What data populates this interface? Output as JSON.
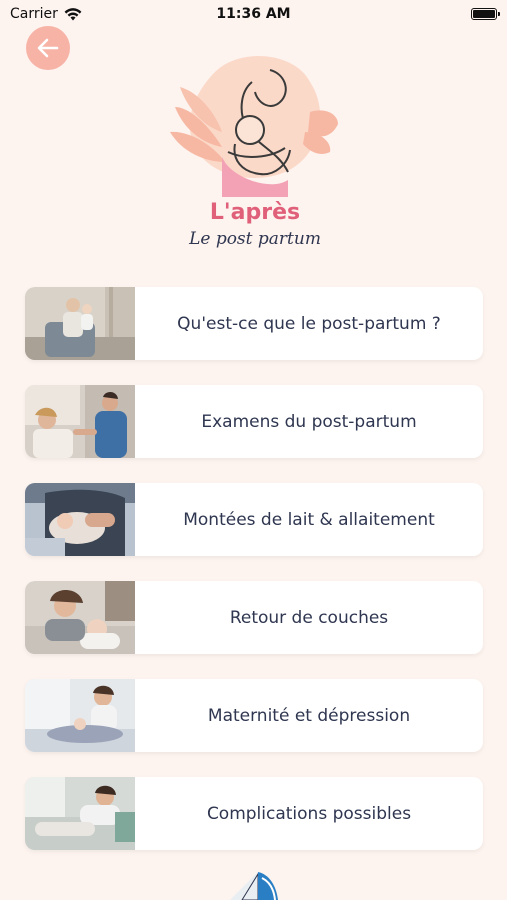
{
  "status_bar": {
    "carrier": "Carrier",
    "time": "11:36 AM"
  },
  "header": {
    "logo_title": "L'après",
    "logo_subtitle": "Le post partum"
  },
  "menu": {
    "items": [
      {
        "label": "Qu'est-ce que le post-partum ?",
        "image": "mother-holding-baby-in-chair"
      },
      {
        "label": "Examens du post-partum",
        "image": "doctor-examining-mother"
      },
      {
        "label": "Montées de lait & allaitement",
        "image": "breastfeeding-mother"
      },
      {
        "label": "Retour de couches",
        "image": "mother-resting-with-baby"
      },
      {
        "label": "Maternité et dépression",
        "image": "mother-sitting-sad"
      },
      {
        "label": "Complications possibles",
        "image": "mother-lying-on-sofa"
      }
    ]
  },
  "colors": {
    "background": "#fdf3ef",
    "accent": "#f7b3a5",
    "title_pink": "#e0607a",
    "text": "#2f3650"
  }
}
